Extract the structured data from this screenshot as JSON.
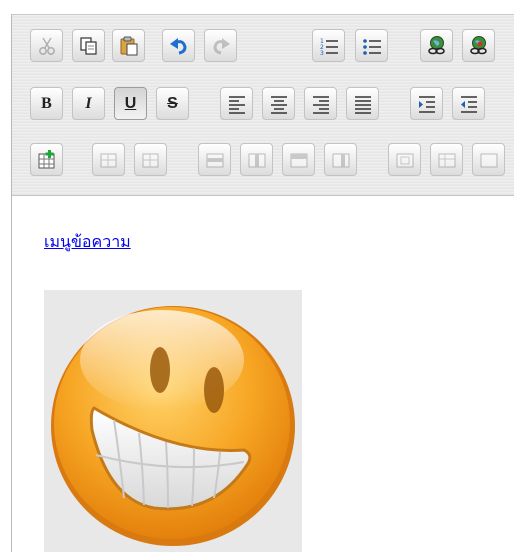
{
  "toolbar": {
    "rows": [
      [
        "cut",
        "copy",
        "paste",
        "undo",
        "redo",
        "ordered-list",
        "unordered-list",
        "link",
        "unlink"
      ],
      [
        "bold",
        "italic",
        "underline",
        "strikethrough",
        "align-left",
        "align-center",
        "align-right",
        "align-justify",
        "indent",
        "outdent"
      ],
      [
        "insert-table",
        "insert-row-before",
        "insert-row-after",
        "delete-row",
        "insert-column",
        "delete-column",
        "merge-cells",
        "split-cell",
        "cell-props",
        "row-props"
      ]
    ],
    "bold_label": "B",
    "italic_label": "I",
    "underline_label": "U",
    "strike_label": "S",
    "active": "underline"
  },
  "content": {
    "link_text": "เมนูข้อความ",
    "image_icon": "grinning-smiley-icon",
    "accent": "#f5a21c"
  }
}
